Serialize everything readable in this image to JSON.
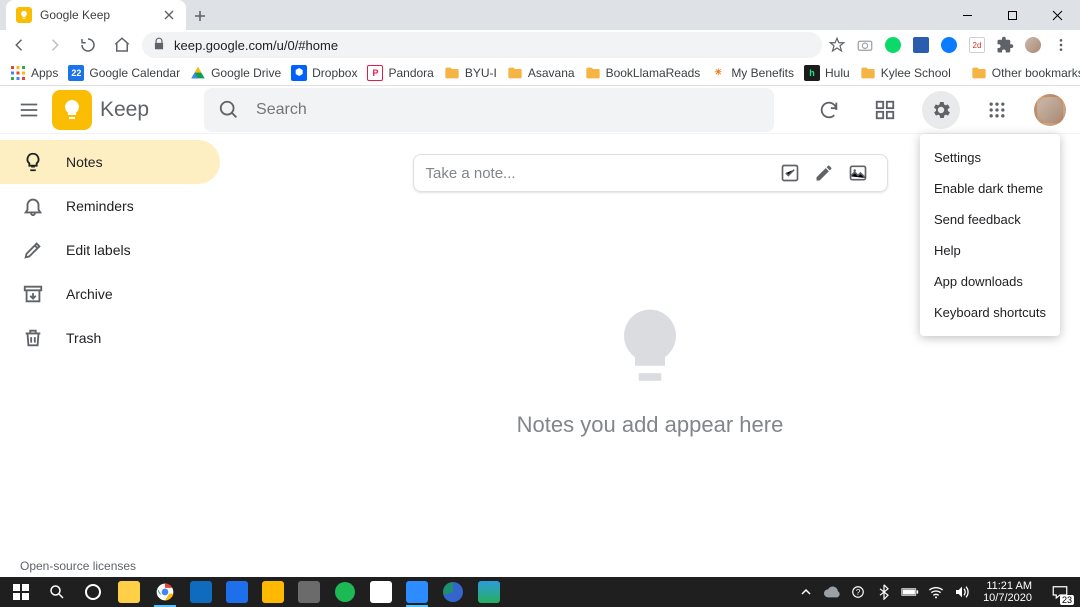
{
  "tab": {
    "title": "Google Keep"
  },
  "url": "keep.google.com/u/0/#home",
  "bookmarks": {
    "apps": "Apps",
    "items": [
      {
        "label": "Google Calendar",
        "color": "#1a73e8",
        "text": "22",
        "tc": "#fff"
      },
      {
        "label": "Google Drive",
        "tri": true
      },
      {
        "label": "Dropbox",
        "color": "#0061fe",
        "glyph": "⬢",
        "tc": "#fff"
      },
      {
        "label": "Pandora",
        "color": "#fff",
        "glyph": "P",
        "tc": "#e6194b",
        "bd": "#e6194b"
      },
      {
        "label": "BYU-I",
        "folder": true
      },
      {
        "label": "Asavana",
        "folder": true
      },
      {
        "label": "BookLlamaReads",
        "folder": true
      },
      {
        "label": "My Benefits",
        "color": "#fff",
        "glyph": "✳",
        "tc": "#e67c22"
      },
      {
        "label": "Hulu",
        "color": "#1c1c1c",
        "glyph": "h",
        "tc": "#1ce783"
      },
      {
        "label": "Kylee School",
        "folder": true
      }
    ],
    "other": "Other bookmarks"
  },
  "keep": {
    "title": "Keep",
    "search_placeholder": "Search",
    "takeNote": "Take a note...",
    "empty": "Notes you add appear here",
    "oss": "Open-source licenses"
  },
  "sidebar": [
    {
      "label": "Notes"
    },
    {
      "label": "Reminders"
    },
    {
      "label": "Edit labels"
    },
    {
      "label": "Archive"
    },
    {
      "label": "Trash"
    }
  ],
  "settingsMenu": [
    "Settings",
    "Enable dark theme",
    "Send feedback",
    "Help",
    "App downloads",
    "Keyboard shortcuts"
  ],
  "clock": {
    "time": "11:21 AM",
    "date": "10/7/2020"
  },
  "tray_badge": "23"
}
